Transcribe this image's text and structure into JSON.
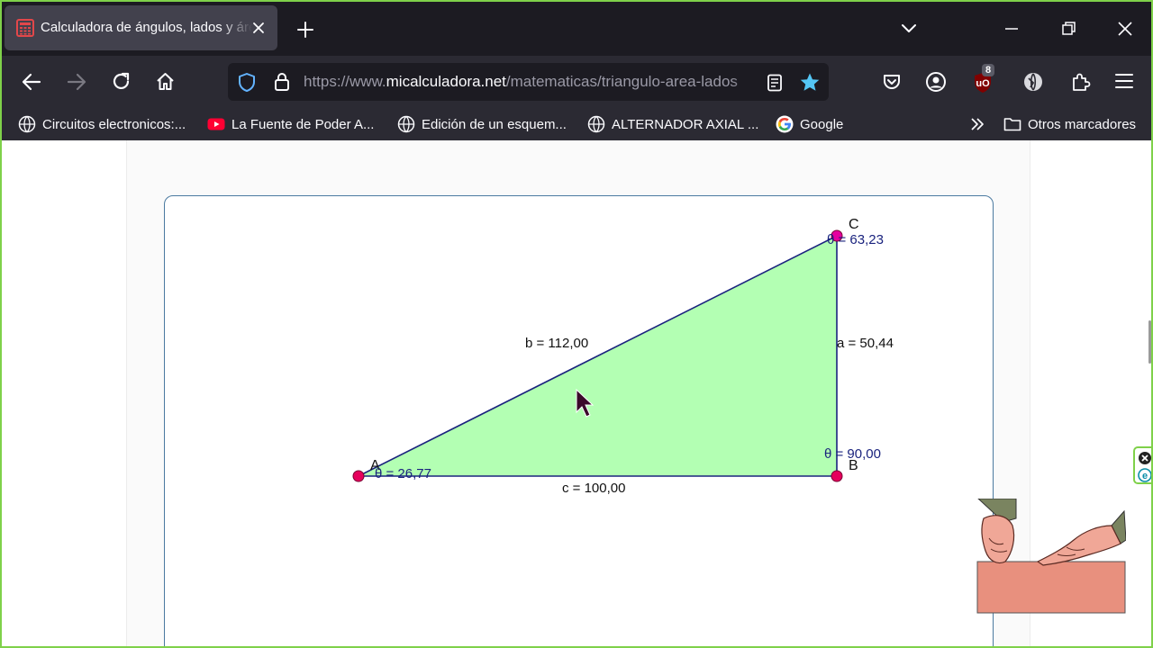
{
  "browser": {
    "tab": {
      "title": "Calculadora de ángulos, lados y áreas"
    },
    "url": {
      "prefix": "https://www.",
      "host": "micalculadora.net",
      "path": "/matematicas/triangulo-area-lados"
    },
    "extensions": {
      "ublock_count": "8"
    }
  },
  "bookmarks": [
    {
      "label": "Circuitos electronicos:...",
      "icon": "globe-icon"
    },
    {
      "label": "La Fuente de Poder A...",
      "icon": "youtube-icon"
    },
    {
      "label": "Edición de un esquem...",
      "icon": "globe-icon"
    },
    {
      "label": "ALTERNADOR AXIAL ...",
      "icon": "globe-icon"
    },
    {
      "label": "Google",
      "icon": "google-icon"
    }
  ],
  "bookmarks_other": "Otros marcadores",
  "triangle": {
    "vertices": {
      "A": "A",
      "B": "B",
      "C": "C"
    },
    "sides": {
      "a": "a = 50,44",
      "b": "b = 112,00",
      "c": "c = 100,00"
    },
    "angles": {
      "A": "θ = 26,77",
      "B": "θ = 90,00",
      "C": "θ = 63,23"
    }
  },
  "colors": {
    "fill": "#b3ffb3",
    "stroke": "#1a237e",
    "point": "#e6005c"
  }
}
